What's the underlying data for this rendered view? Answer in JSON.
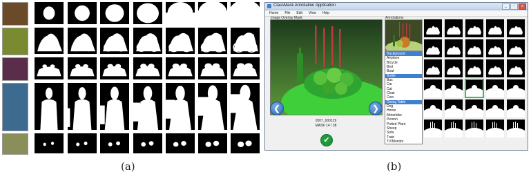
{
  "captions": {
    "a": "(a)",
    "b": "(b)"
  },
  "app": {
    "title": "ClassMask Annotation Application",
    "menu": [
      "Home",
      "File",
      "Edit",
      "View",
      "Help"
    ],
    "image_panel_label": "Image Overlay Mask",
    "annotations_label": "Annotations",
    "image_id": "2007_000129",
    "mask_counter": "MASK 14 / 38",
    "prev_glyph": "❮",
    "next_glyph": "❯",
    "ok_glyph": "✔",
    "classes": [
      {
        "label": "Background",
        "selected": true
      },
      {
        "label": "Airplane",
        "selected": false
      },
      {
        "label": "Bicycle",
        "selected": false
      },
      {
        "label": "Bird",
        "selected": false
      },
      {
        "label": "Boat",
        "selected": false
      },
      {
        "label": "Bottle",
        "selected": true
      },
      {
        "label": "Bus",
        "selected": false
      },
      {
        "label": "Car",
        "selected": false
      },
      {
        "label": "Cat",
        "selected": false
      },
      {
        "label": "Chair",
        "selected": false
      },
      {
        "label": "Cow",
        "selected": false
      },
      {
        "label": "Dining Table",
        "selected": true
      },
      {
        "label": "Dog",
        "selected": false
      },
      {
        "label": "Horse",
        "selected": false
      },
      {
        "label": "Motorbike",
        "selected": false
      },
      {
        "label": "Person",
        "selected": false
      },
      {
        "label": "Potted Plant",
        "selected": false
      },
      {
        "label": "Sheep",
        "selected": false
      },
      {
        "label": "Sofa",
        "selected": false
      },
      {
        "label": "Train",
        "selected": false
      },
      {
        "label": "TV/Monitor",
        "selected": false
      }
    ],
    "grid": {
      "rows": 6,
      "cols": 5,
      "highlighted_row": 3,
      "highlighted_col": 2
    }
  },
  "colors": {
    "selection": "#3d7fd0",
    "highlight": "#3dc04a",
    "mask_overlay": "#39d33a"
  },
  "icons": {
    "prev": "arrow-left-icon",
    "next": "arrow-right-icon",
    "accept": "check-icon"
  }
}
